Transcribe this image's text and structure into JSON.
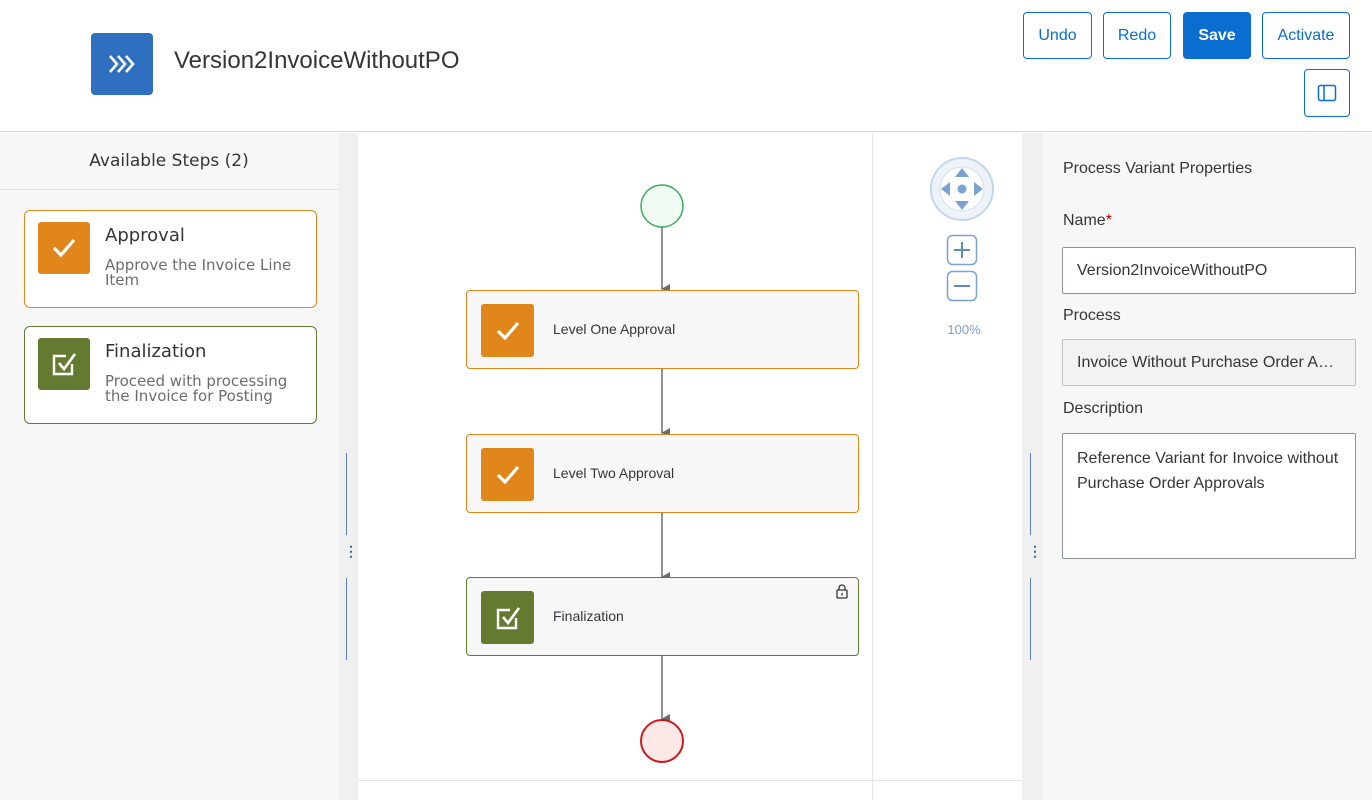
{
  "header": {
    "title": "Version2InvoiceWithoutPO",
    "app_icon": "chevrons-right-icon",
    "buttons": {
      "undo": "Undo",
      "redo": "Redo",
      "save": "Save",
      "activate": "Activate"
    },
    "panel_toggle_icon": "side-panel-icon"
  },
  "available_steps": {
    "title": "Available Steps (2)",
    "items": [
      {
        "name": "Approval",
        "description": "Approve the Invoice Line Item",
        "icon": "checkmark-icon",
        "color": "#e0861b"
      },
      {
        "name": "Finalization",
        "description": "Proceed with processing the Invoice for Posting",
        "icon": "checkbox-check-icon",
        "color": "#647a31"
      }
    ]
  },
  "flow": {
    "start_event": "start-event",
    "nodes": [
      {
        "label": "Level One Approval",
        "icon": "checkmark-icon",
        "color": "#e0861b"
      },
      {
        "label": "Level Two Approval",
        "icon": "checkmark-icon",
        "color": "#e0861b"
      },
      {
        "label": "Finalization",
        "icon": "checkbox-check-icon",
        "color": "#647a31",
        "locked": true
      }
    ],
    "end_event": "end-event",
    "zoom": "100%"
  },
  "properties": {
    "title": "Process Variant Properties",
    "name_label": "Name",
    "name_required": "*",
    "name_value": "Version2InvoiceWithoutPO",
    "process_label": "Process",
    "process_value": "Invoice Without Purchase Order Approvals",
    "description_label": "Description",
    "description_value": "Reference Variant for Invoice without Purchase Order Approvals"
  }
}
